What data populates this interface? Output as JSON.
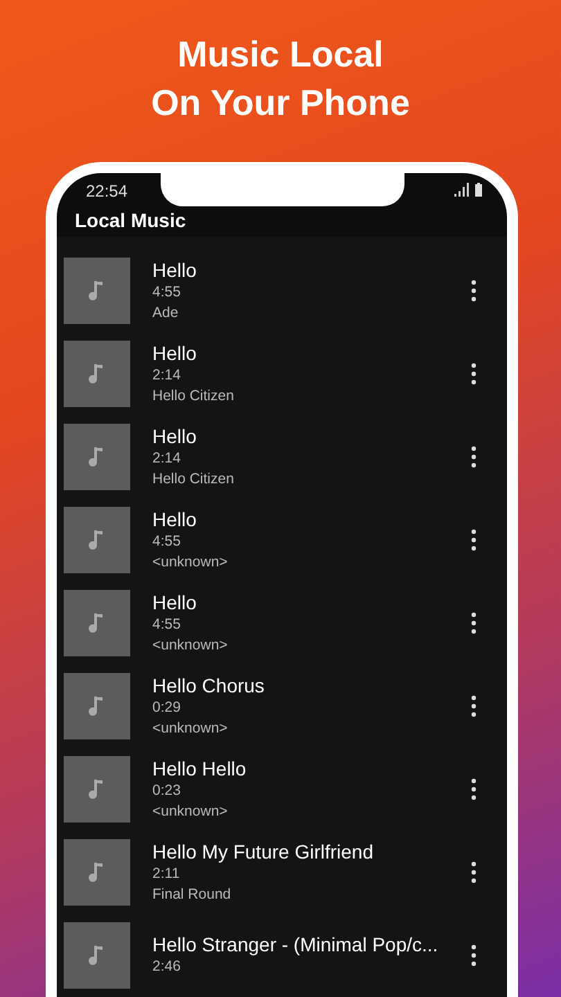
{
  "headline": [
    "Music Local",
    "On Your Phone"
  ],
  "status_bar": {
    "time": "22:54"
  },
  "app_bar": {
    "title": "Local Music"
  },
  "songs": [
    {
      "title": "Hello",
      "duration": "4:55",
      "artist": "Ade"
    },
    {
      "title": "Hello",
      "duration": "2:14",
      "artist": "Hello Citizen"
    },
    {
      "title": "Hello",
      "duration": "2:14",
      "artist": "Hello Citizen"
    },
    {
      "title": "Hello",
      "duration": "4:55",
      "artist": "<unknown>"
    },
    {
      "title": "Hello",
      "duration": "4:55",
      "artist": "<unknown>"
    },
    {
      "title": "Hello Chorus",
      "duration": "0:29",
      "artist": "<unknown>"
    },
    {
      "title": "Hello Hello",
      "duration": "0:23",
      "artist": "<unknown>"
    },
    {
      "title": "Hello My Future Girlfriend",
      "duration": "2:11",
      "artist": "Final Round"
    },
    {
      "title": "Hello Stranger - (Minimal Pop/c...",
      "duration": "2:46"
    }
  ]
}
